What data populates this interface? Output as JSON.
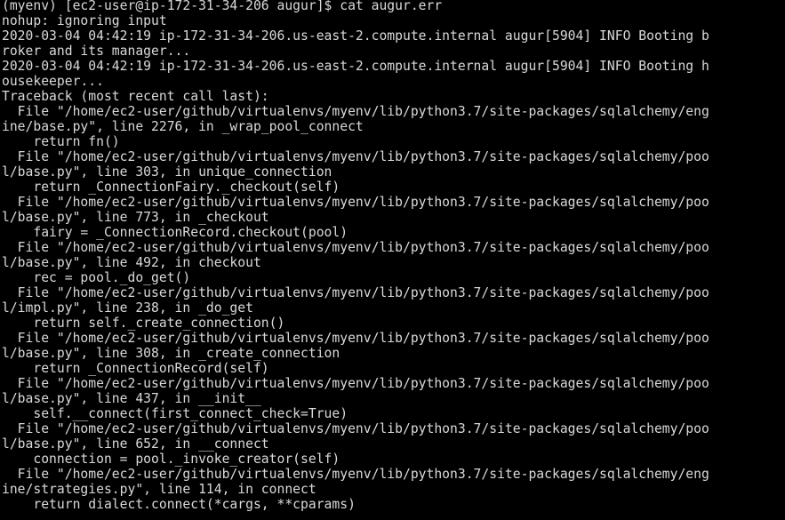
{
  "terminal": {
    "lines": [
      "(myenv) [ec2-user@ip-172-31-34-206 augur]$ cat augur.err",
      "nohup: ignoring input",
      "2020-03-04 04:42:19 ip-172-31-34-206.us-east-2.compute.internal augur[5904] INFO Booting b",
      "roker and its manager...",
      "2020-03-04 04:42:19 ip-172-31-34-206.us-east-2.compute.internal augur[5904] INFO Booting h",
      "ousekeeper...",
      "Traceback (most recent call last):",
      "  File \"/home/ec2-user/github/virtualenvs/myenv/lib/python3.7/site-packages/sqlalchemy/eng",
      "ine/base.py\", line 2276, in _wrap_pool_connect",
      "    return fn()",
      "  File \"/home/ec2-user/github/virtualenvs/myenv/lib/python3.7/site-packages/sqlalchemy/poo",
      "l/base.py\", line 303, in unique_connection",
      "    return _ConnectionFairy._checkout(self)",
      "  File \"/home/ec2-user/github/virtualenvs/myenv/lib/python3.7/site-packages/sqlalchemy/poo",
      "l/base.py\", line 773, in _checkout",
      "    fairy = _ConnectionRecord.checkout(pool)",
      "  File \"/home/ec2-user/github/virtualenvs/myenv/lib/python3.7/site-packages/sqlalchemy/poo",
      "l/base.py\", line 492, in checkout",
      "    rec = pool._do_get()",
      "  File \"/home/ec2-user/github/virtualenvs/myenv/lib/python3.7/site-packages/sqlalchemy/poo",
      "l/impl.py\", line 238, in _do_get",
      "    return self._create_connection()",
      "  File \"/home/ec2-user/github/virtualenvs/myenv/lib/python3.7/site-packages/sqlalchemy/poo",
      "l/base.py\", line 308, in _create_connection",
      "    return _ConnectionRecord(self)",
      "  File \"/home/ec2-user/github/virtualenvs/myenv/lib/python3.7/site-packages/sqlalchemy/poo",
      "l/base.py\", line 437, in __init__",
      "    self.__connect(first_connect_check=True)",
      "  File \"/home/ec2-user/github/virtualenvs/myenv/lib/python3.7/site-packages/sqlalchemy/poo",
      "l/base.py\", line 652, in __connect",
      "    connection = pool._invoke_creator(self)",
      "  File \"/home/ec2-user/github/virtualenvs/myenv/lib/python3.7/site-packages/sqlalchemy/eng",
      "ine/strategies.py\", line 114, in connect",
      "    return dialect.connect(*cargs, **cparams)"
    ]
  }
}
